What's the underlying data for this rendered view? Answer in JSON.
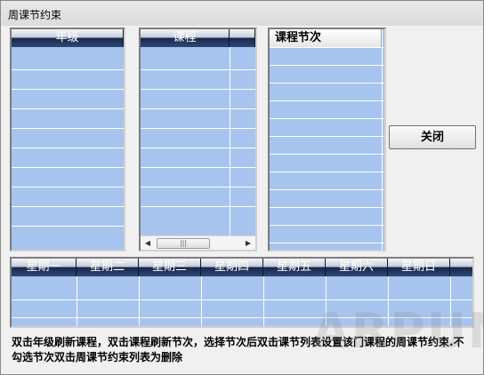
{
  "window": {
    "title": "周课节约束"
  },
  "grade_list": {
    "header": "年级"
  },
  "course_list": {
    "header": "课程"
  },
  "period_list": {
    "header": "课程节次"
  },
  "close_button": {
    "label": "关闭"
  },
  "week_table": {
    "headers": [
      "星期一",
      "星期二",
      "星期三",
      "星期四",
      "星期五",
      "星期六",
      "星期日"
    ]
  },
  "hint_text": "双击年级刷新课程，双击课程刷新节次，选择节次后双击课节列表设置该门课程的周课节约束.不勾选节次双击周课节约束列表为删除",
  "watermark": "ARPUN"
}
